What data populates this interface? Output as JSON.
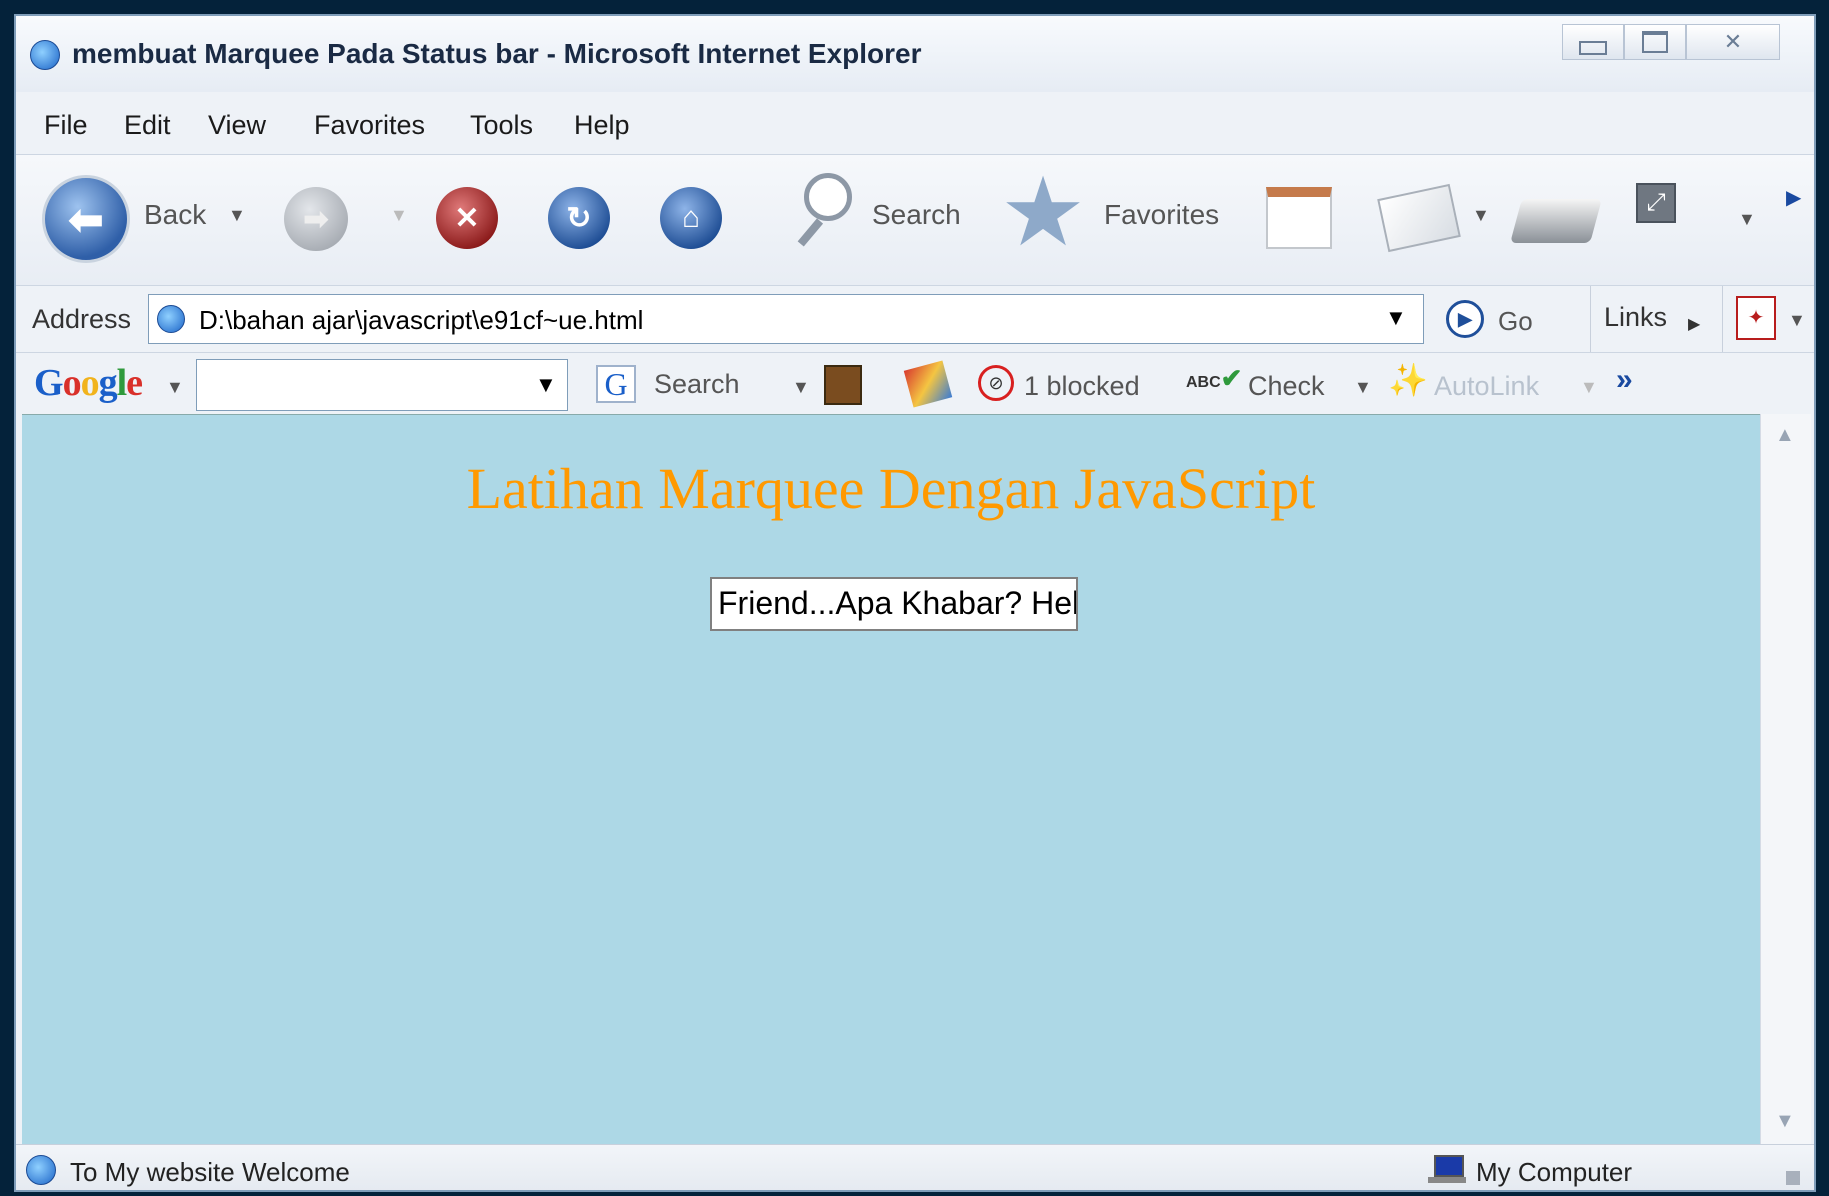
{
  "window": {
    "title": "membuat Marquee Pada Status bar - Microsoft Internet Explorer",
    "controls": {
      "minimize": "▭",
      "maximize": "▭",
      "close": "✕"
    }
  },
  "menu": {
    "file": "File",
    "edit": "Edit",
    "view": "View",
    "favorites": "Favorites",
    "tools": "Tools",
    "help": "Help"
  },
  "toolbar": {
    "back": "Back",
    "search": "Search",
    "favorites": "Favorites"
  },
  "address": {
    "label": "Address",
    "value": "D:\\bahan ajar\\javascript\\e91cf~ue.html",
    "go": "Go",
    "links": "Links"
  },
  "google": {
    "search": "Search",
    "blocked": "1 blocked",
    "check": "Check",
    "autolink": "AutoLink",
    "more": "»"
  },
  "page": {
    "heading": "Latihan Marquee Dengan JavaScript",
    "marquee_text": "Friend...Apa Khabar? Hello"
  },
  "status": {
    "message": "To My website Welcome",
    "zone": "My Computer"
  },
  "colors": {
    "content_bg": "#add8e6",
    "heading": "#ff9900"
  }
}
